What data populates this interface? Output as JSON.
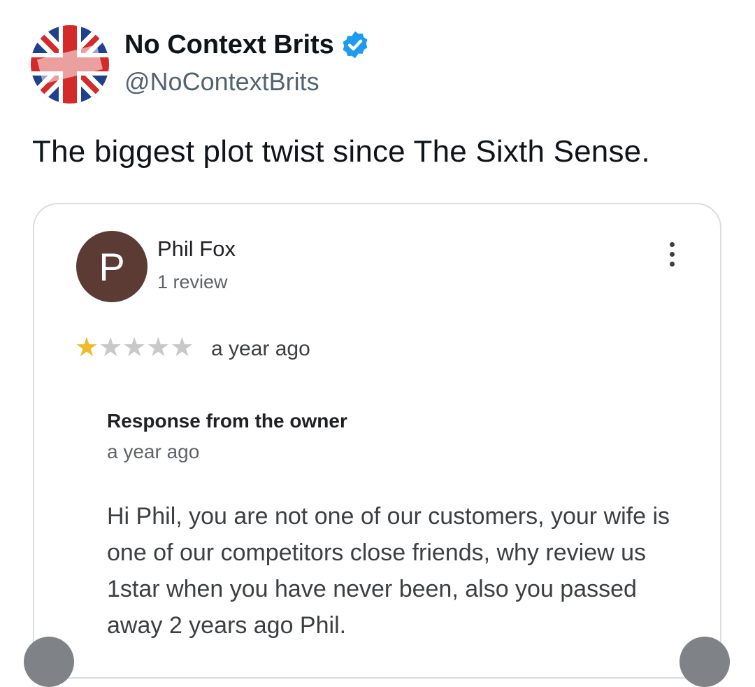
{
  "tweet": {
    "display_name": "No Context Brits",
    "handle": "@NoContextBrits",
    "verified_icon": "verified-badge-icon",
    "avatar_icon": "union-jack-logo",
    "text": "The biggest plot twist since The Sixth Sense."
  },
  "review": {
    "avatar_letter": "P",
    "avatar_color": "#5b3b34",
    "reviewer_name": "Phil Fox",
    "review_count": "1 review",
    "rating": 1,
    "rating_max": 5,
    "time": "a year ago",
    "more_icon": "more-vertical-icon"
  },
  "response": {
    "title": "Response from the owner",
    "time": "a year ago",
    "body": "Hi Phil, you are not one of our customers, your wife is one of our competitors close friends, why review us 1star when you have never been, also you passed away 2 years ago Phil."
  },
  "colors": {
    "star_filled": "#f2b92d",
    "star_empty": "#c8c8c8",
    "verified": "#1d9bf0"
  }
}
